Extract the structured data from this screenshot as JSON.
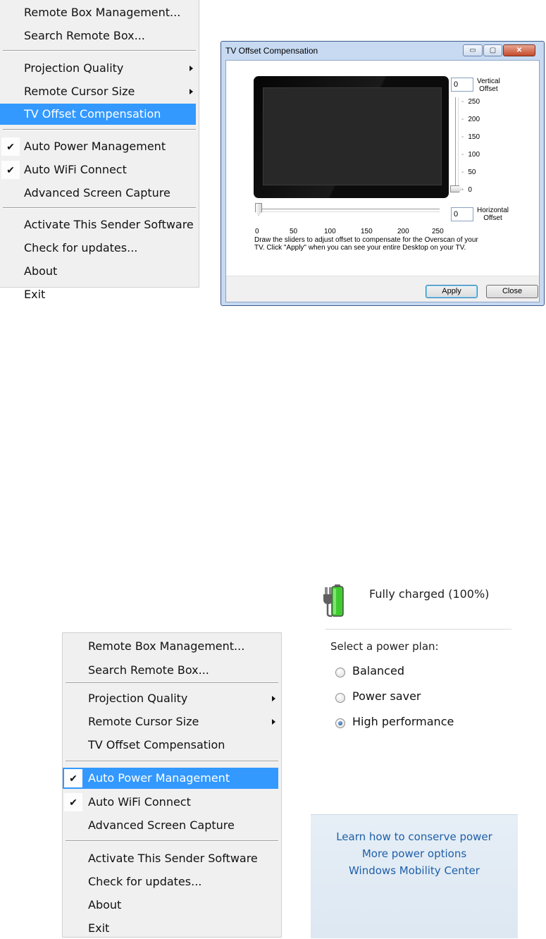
{
  "menu_top": {
    "items": [
      {
        "label": "Remote Box Management...",
        "submenu": false,
        "checked": false,
        "highlighted": false
      },
      {
        "label": "Search Remote Box...",
        "submenu": false,
        "checked": false,
        "highlighted": false
      },
      {
        "label": "Projection Quality",
        "submenu": true,
        "checked": false,
        "highlighted": false
      },
      {
        "label": "Remote Cursor Size",
        "submenu": true,
        "checked": false,
        "highlighted": false
      },
      {
        "label": "TV Offset Compensation",
        "submenu": false,
        "checked": false,
        "highlighted": true
      },
      {
        "label": "Auto Power Management",
        "submenu": false,
        "checked": true,
        "highlighted": false
      },
      {
        "label": "Auto WiFi Connect",
        "submenu": false,
        "checked": true,
        "highlighted": false
      },
      {
        "label": "Advanced Screen Capture",
        "submenu": false,
        "checked": false,
        "highlighted": false
      },
      {
        "label": "Activate This Sender Software",
        "submenu": false,
        "checked": false,
        "highlighted": false
      },
      {
        "label": "Check for updates...",
        "submenu": false,
        "checked": false,
        "highlighted": false
      },
      {
        "label": "About",
        "submenu": false,
        "checked": false,
        "highlighted": false
      },
      {
        "label": "Exit",
        "submenu": false,
        "checked": false,
        "highlighted": false
      }
    ]
  },
  "menu_bottom": {
    "items": [
      {
        "label": "Remote Box Management...",
        "submenu": false,
        "checked": false,
        "highlighted": false
      },
      {
        "label": "Search Remote Box...",
        "submenu": false,
        "checked": false,
        "highlighted": false
      },
      {
        "label": "Projection Quality",
        "submenu": true,
        "checked": false,
        "highlighted": false
      },
      {
        "label": "Remote Cursor Size",
        "submenu": true,
        "checked": false,
        "highlighted": false
      },
      {
        "label": "TV Offset Compensation",
        "submenu": false,
        "checked": false,
        "highlighted": false
      },
      {
        "label": "Auto Power Management",
        "submenu": false,
        "checked": true,
        "highlighted": true
      },
      {
        "label": "Auto WiFi Connect",
        "submenu": false,
        "checked": true,
        "highlighted": false
      },
      {
        "label": "Advanced Screen Capture",
        "submenu": false,
        "checked": false,
        "highlighted": false
      },
      {
        "label": "Activate This Sender Software",
        "submenu": false,
        "checked": false,
        "highlighted": false
      },
      {
        "label": "Check for updates...",
        "submenu": false,
        "checked": false,
        "highlighted": false
      },
      {
        "label": "About",
        "submenu": false,
        "checked": false,
        "highlighted": false
      },
      {
        "label": "Exit",
        "submenu": false,
        "checked": false,
        "highlighted": false
      }
    ]
  },
  "check_glyph": "✔",
  "dialog": {
    "title": "TV Offset Compensation",
    "minimize_glyph": "▭",
    "maximize_glyph": "▢",
    "close_glyph": "✕",
    "vertical_offset_value": "0",
    "vertical_offset_label_1": "Vertical",
    "vertical_offset_label_2": "Offset",
    "vertical_ticks": [
      "250",
      "200",
      "150",
      "100",
      "50",
      "0"
    ],
    "horizontal_offset_value": "0",
    "horizontal_offset_label_1": "Horizontal",
    "horizontal_offset_label_2": "Offset",
    "horizontal_ticks": [
      "0",
      "50",
      "100",
      "150",
      "200",
      "250"
    ],
    "instruction_1": "Draw the sliders to adjust offset to compensate for the Overscan of your",
    "instruction_2": "TV. Click \"Apply\" when you can see your entire Desktop on your TV.",
    "apply_label": "Apply",
    "close_label": "Close"
  },
  "power": {
    "status": "Fully charged (100%)",
    "plan_title": "Select a power plan:",
    "plans": [
      {
        "label": "Balanced",
        "selected": false
      },
      {
        "label": "Power saver",
        "selected": false
      },
      {
        "label": "High performance",
        "selected": true
      }
    ],
    "links": [
      "Learn how to conserve power",
      "More power options",
      "Windows Mobility Center"
    ]
  },
  "colors": {
    "highlight": "#3399ff",
    "menu_bg": "#f0f0f0",
    "link": "#1e5fa8",
    "battery_green": "#3fcb2f"
  }
}
